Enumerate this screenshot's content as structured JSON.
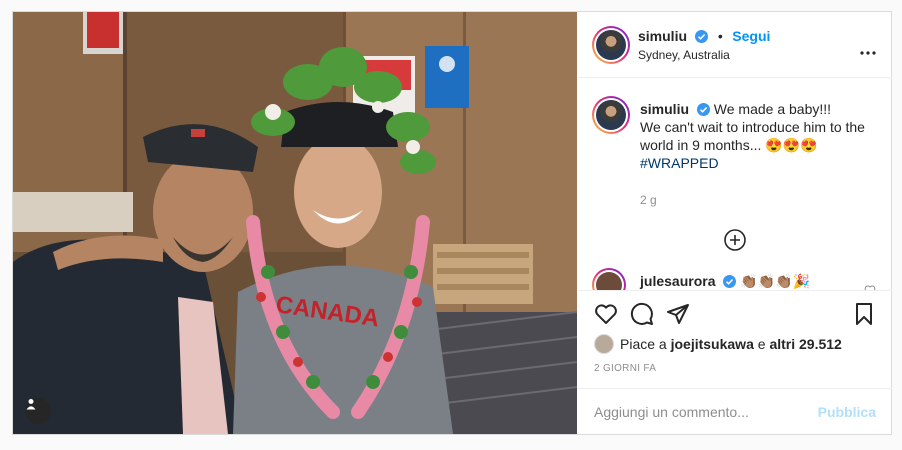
{
  "post": {
    "username": "simuliu",
    "follow_label": "Segui",
    "dot": "•",
    "location": "Sydney, Australia",
    "more_icon": "more-horizontal-icon",
    "verified_icon": "verified-badge-icon",
    "caption": {
      "username": "simuliu",
      "line1": "We made a baby!!!",
      "line2": "We can't wait to introduce him to the world in 9 months... 😍😍😍",
      "hashtag": "#WRAPPED",
      "time": "2 g"
    },
    "load_more_icon": "plus-circle-icon",
    "second_comment": {
      "username": "jules​aurora",
      "text": "👏🏽👏🏽👏🏽🎉"
    },
    "actions": {
      "like_icon": "heart-icon",
      "comment_icon": "comment-icon",
      "share_icon": "paper-plane-icon",
      "save_icon": "bookmark-icon"
    },
    "likes": {
      "prefix": "Piace a",
      "user": "joejitsukawa",
      "conj": "e",
      "others": "altri 29.512"
    },
    "date": "2 GIORNI FA",
    "comment_box": {
      "placeholder": "Aggiungi un commento...",
      "publish_label": "Pubblica"
    },
    "photo_tag_icon": "user-tag-icon"
  },
  "colors": {
    "accent": "#0095f6",
    "publish_disabled": "#b2dffc",
    "muted": "#8e8e8e",
    "hashtag": "#00376b"
  }
}
